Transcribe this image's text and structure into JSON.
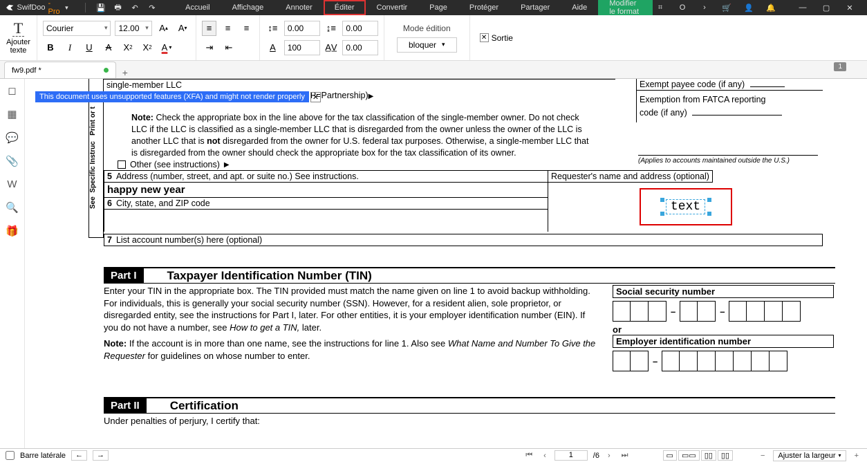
{
  "app": {
    "name": "SwifDoo",
    "suffix": "-Pro"
  },
  "menu": [
    "Accueil",
    "Affichage",
    "Annoter",
    "Éditer",
    "Convertir",
    "Page",
    "Protéger",
    "Partager",
    "Aide",
    "Modifier le format"
  ],
  "right_icons": [
    "⌗",
    "O",
    "›",
    "🛒",
    "👤",
    "🔔"
  ],
  "ribbon": {
    "add_text_l1": "Ajouter",
    "add_text_l2": "texte",
    "font": "Courier",
    "size": "12.00",
    "line_sp_a": "0.00",
    "line_sp_b": "0.00",
    "char_sp_a": "100",
    "char_sp_b": "0.00",
    "edit_mode": "Mode édition",
    "block": "bloquer",
    "exit": "Sortie"
  },
  "tab": {
    "name": "fw9.pdf *",
    "page_badge": "1"
  },
  "warning": "This document uses unsupported features (XFA) and might not render properly",
  "doc": {
    "vlabel": "Print or t",
    "vlabel2": "Specific Instruc",
    "vlabel3": "See",
    "line_single": "single-member LLC",
    "tax_codes": "C corporation, S=S corporation, P=Partnership)",
    "note_label": "Note:",
    "note_body_1": "Check the appropriate box in the line above for the tax classification of the single-member owner.  Do not check",
    "note_body_2": "LLC if the LLC is classified as a single-member LLC that is disregarded from the owner unless the owner of the LLC is",
    "note_body_3a": "another LLC that is ",
    "note_body_3b": "not",
    "note_body_3c": " disregarded from the owner for U.S. federal tax purposes. Otherwise, a single-member LLC that",
    "note_body_4": "is disregarded from the owner should check the appropriate box for the tax classification of its owner.",
    "other": "Other (see instructions)",
    "exempt_payee": "Exempt payee code (if any)",
    "fatca_1": "Exemption from FATCA reporting",
    "fatca_2": "code (if any)",
    "applies": "(Applies to accounts maintained outside the U.S.)",
    "line5_num": "5",
    "line5": "Address (number, street, and apt. or suite no.) See instructions.",
    "happy": "happy new year",
    "line6_num": "6",
    "line6": "City, state, and ZIP code",
    "line7_num": "7",
    "line7": "List account number(s) here (optional)",
    "requester": "Requester's name and address (optional)",
    "selected_text": "text",
    "part1": "Part I",
    "tin_title": "Taxpayer Identification Number (TIN)",
    "tin_p1": "Enter your TIN in the appropriate box. The TIN provided must match the name given on line 1 to avoid backup withholding. For individuals, this is generally your social security number (SSN). However, for a resident alien, sole proprietor, or disregarded entity, see the instructions for Part I, later. For other entities, it is your employer identification number (EIN). If you do not have a number, see ",
    "tin_p1_it": "How to get a TIN,",
    "tin_p1_end": " later.",
    "tin_n_label": "Note:",
    "tin_n1": " If the account is in more than one name, see the instructions for line 1. Also see ",
    "tin_n_it": "What Name and Number To Give the Requester",
    "tin_n2": " for guidelines on whose number to enter.",
    "ssn_label": "Social security number",
    "or": "or",
    "ein_label": "Employer identification number",
    "part2": "Part II",
    "cert": "Certification",
    "cert_line": "Under penalties of perjury, I certify that:"
  },
  "status": {
    "side": "Barre latérale",
    "page": "1",
    "total": "/6",
    "zoom": "Ajuster la largeur"
  }
}
